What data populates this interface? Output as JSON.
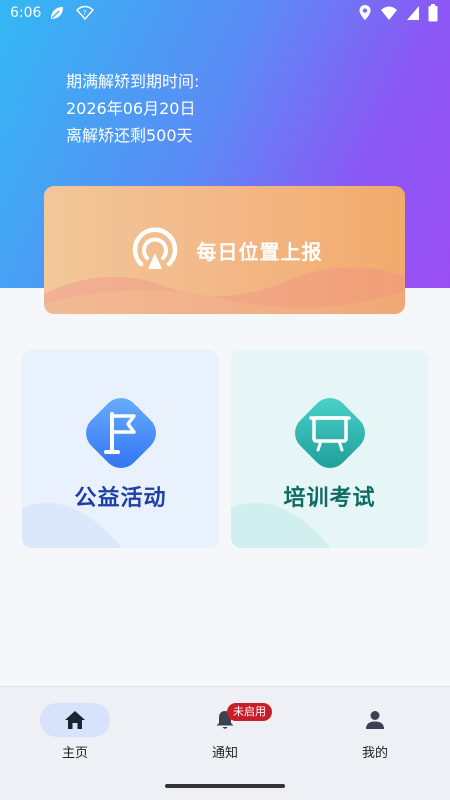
{
  "status_bar": {
    "time": "6:06",
    "icons": [
      "leaf-icon",
      "wifi-question-icon",
      "location-icon",
      "wifi-icon",
      "signal-icon",
      "battery-icon"
    ]
  },
  "info": {
    "line1": "期满解矫到期时间:",
    "line2": "2026年06月20日",
    "line3": "离解矫还剩500天"
  },
  "report": {
    "label": "每日位置上报",
    "icon": "location-broadcast-icon"
  },
  "tiles": [
    {
      "label": "公益活动",
      "icon": "flag-icon",
      "color": "#1f3fa8"
    },
    {
      "label": "培训考试",
      "icon": "whiteboard-icon",
      "color": "#0f6b63"
    }
  ],
  "nav": {
    "items": [
      {
        "label": "主页",
        "icon": "home-icon",
        "active": true
      },
      {
        "label": "通知",
        "icon": "bell-icon",
        "badge": "未启用"
      },
      {
        "label": "我的",
        "icon": "person-icon"
      }
    ]
  },
  "colors": {
    "hero_start": "#33b8f3",
    "hero_end": "#9a4ef2",
    "report_start": "#f2c79a",
    "report_end": "#f1ab6b",
    "badge": "#c81e2a"
  }
}
